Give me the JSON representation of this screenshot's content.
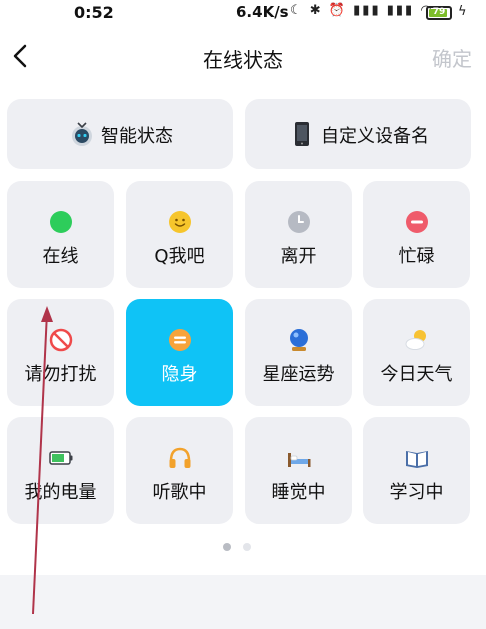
{
  "status_bar": {
    "time": "0:52",
    "network_speed": "6.4K/s",
    "icons_text": "☾ ✱ ⏰ ▮▮▮ ▮▮▮ ◠",
    "battery": "79"
  },
  "header": {
    "title": "在线状态",
    "confirm_label": "确定"
  },
  "wide_tiles": [
    {
      "label": "智能状态",
      "icon": "robot-icon"
    },
    {
      "label": "自定义设备名",
      "icon": "phone-icon"
    }
  ],
  "status_tiles": [
    {
      "label": "在线",
      "icon": "online-dot-icon"
    },
    {
      "label": "Q我吧",
      "icon": "smiley-icon"
    },
    {
      "label": "离开",
      "icon": "clock-icon"
    },
    {
      "label": "忙碌",
      "icon": "busy-icon"
    },
    {
      "label": "请勿打扰",
      "icon": "no-entry-icon"
    },
    {
      "label": "隐身",
      "icon": "invisible-icon",
      "selected": true
    },
    {
      "label": "星座运势",
      "icon": "crystal-ball-icon"
    },
    {
      "label": "今日天气",
      "icon": "weather-icon"
    },
    {
      "label": "我的电量",
      "icon": "battery-icon"
    },
    {
      "label": "听歌中",
      "icon": "headphones-icon"
    },
    {
      "label": "睡觉中",
      "icon": "bed-icon"
    },
    {
      "label": "学习中",
      "icon": "book-icon"
    }
  ],
  "pager": {
    "total": 2,
    "active": 1
  },
  "colors": {
    "accent": "#0fc3f6",
    "tile_bg": "#eeeff3",
    "online": "#2dcd5b",
    "busy": "#ef5b6b",
    "away": "#b6bac3",
    "annotation_arrow": "#b0344a"
  }
}
